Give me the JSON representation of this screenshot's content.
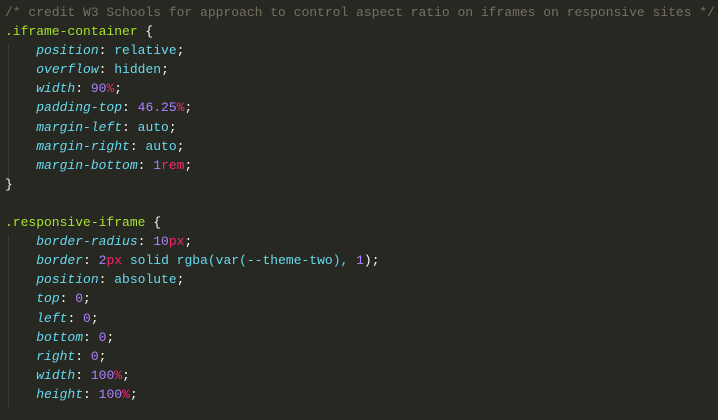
{
  "lines": [
    [
      {
        "t": "/* credit W3 Schools for approach to control aspect ratio on iframes on responsive sites */",
        "c": "comment"
      }
    ],
    [
      {
        "t": ".iframe-container",
        "c": "selector"
      },
      {
        "t": " {",
        "c": "brace"
      }
    ],
    [
      {
        "t": "    "
      },
      {
        "t": "position",
        "c": "prop"
      },
      {
        "t": ": ",
        "c": "punct"
      },
      {
        "t": "relative",
        "c": "value"
      },
      {
        "t": ";",
        "c": "punct"
      }
    ],
    [
      {
        "t": "    "
      },
      {
        "t": "overflow",
        "c": "prop"
      },
      {
        "t": ": ",
        "c": "punct"
      },
      {
        "t": "hidden",
        "c": "value"
      },
      {
        "t": ";",
        "c": "punct"
      }
    ],
    [
      {
        "t": "    "
      },
      {
        "t": "width",
        "c": "prop"
      },
      {
        "t": ": ",
        "c": "punct"
      },
      {
        "t": "90",
        "c": "num"
      },
      {
        "t": "%",
        "c": "unit"
      },
      {
        "t": ";",
        "c": "punct"
      }
    ],
    [
      {
        "t": "    "
      },
      {
        "t": "padding-top",
        "c": "prop"
      },
      {
        "t": ": ",
        "c": "punct"
      },
      {
        "t": "46.25",
        "c": "num"
      },
      {
        "t": "%",
        "c": "unit"
      },
      {
        "t": ";",
        "c": "punct"
      }
    ],
    [
      {
        "t": "    "
      },
      {
        "t": "margin-left",
        "c": "prop"
      },
      {
        "t": ": ",
        "c": "punct"
      },
      {
        "t": "auto",
        "c": "value"
      },
      {
        "t": ";",
        "c": "punct"
      }
    ],
    [
      {
        "t": "    "
      },
      {
        "t": "margin-right",
        "c": "prop"
      },
      {
        "t": ": ",
        "c": "punct"
      },
      {
        "t": "auto",
        "c": "value"
      },
      {
        "t": ";",
        "c": "punct"
      }
    ],
    [
      {
        "t": "    "
      },
      {
        "t": "margin-bottom",
        "c": "prop"
      },
      {
        "t": ": ",
        "c": "punct"
      },
      {
        "t": "1",
        "c": "num"
      },
      {
        "t": "rem",
        "c": "unit"
      },
      {
        "t": ";",
        "c": "punct"
      }
    ],
    [
      {
        "t": "}",
        "c": "brace"
      }
    ],
    [],
    [
      {
        "t": ".responsive-iframe",
        "c": "selector"
      },
      {
        "t": " {",
        "c": "brace"
      }
    ],
    [
      {
        "t": "    "
      },
      {
        "t": "border-radius",
        "c": "prop"
      },
      {
        "t": ": ",
        "c": "punct"
      },
      {
        "t": "10",
        "c": "num"
      },
      {
        "t": "px",
        "c": "unit"
      },
      {
        "t": ";",
        "c": "punct"
      }
    ],
    [
      {
        "t": "    "
      },
      {
        "t": "border",
        "c": "prop"
      },
      {
        "t": ": ",
        "c": "punct"
      },
      {
        "t": "2",
        "c": "num"
      },
      {
        "t": "px",
        "c": "unit"
      },
      {
        "t": " solid rgba(var(--theme-two), ",
        "c": "value"
      },
      {
        "t": "1",
        "c": "num"
      },
      {
        "t": ");",
        "c": "punct"
      }
    ],
    [
      {
        "t": "    "
      },
      {
        "t": "position",
        "c": "prop"
      },
      {
        "t": ": ",
        "c": "punct"
      },
      {
        "t": "absolute",
        "c": "value"
      },
      {
        "t": ";",
        "c": "punct"
      }
    ],
    [
      {
        "t": "    "
      },
      {
        "t": "top",
        "c": "prop"
      },
      {
        "t": ": ",
        "c": "punct"
      },
      {
        "t": "0",
        "c": "num"
      },
      {
        "t": ";",
        "c": "punct"
      }
    ],
    [
      {
        "t": "    "
      },
      {
        "t": "left",
        "c": "prop"
      },
      {
        "t": ": ",
        "c": "punct"
      },
      {
        "t": "0",
        "c": "num"
      },
      {
        "t": ";",
        "c": "punct"
      }
    ],
    [
      {
        "t": "    "
      },
      {
        "t": "bottom",
        "c": "prop"
      },
      {
        "t": ": ",
        "c": "punct"
      },
      {
        "t": "0",
        "c": "num"
      },
      {
        "t": ";",
        "c": "punct"
      }
    ],
    [
      {
        "t": "    "
      },
      {
        "t": "right",
        "c": "prop"
      },
      {
        "t": ": ",
        "c": "punct"
      },
      {
        "t": "0",
        "c": "num"
      },
      {
        "t": ";",
        "c": "punct"
      }
    ],
    [
      {
        "t": "    "
      },
      {
        "t": "width",
        "c": "prop"
      },
      {
        "t": ": ",
        "c": "punct"
      },
      {
        "t": "100",
        "c": "num"
      },
      {
        "t": "%",
        "c": "unit"
      },
      {
        "t": ";",
        "c": "punct"
      }
    ],
    [
      {
        "t": "    "
      },
      {
        "t": "height",
        "c": "prop"
      },
      {
        "t": ": ",
        "c": "punct"
      },
      {
        "t": "100",
        "c": "num"
      },
      {
        "t": "%",
        "c": "unit"
      },
      {
        "t": ";",
        "c": "punct"
      }
    ]
  ]
}
